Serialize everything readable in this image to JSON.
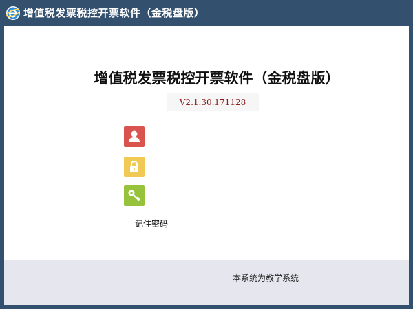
{
  "window": {
    "title": "增值税发票税控开票软件（金税盘版）",
    "app_icon": "ie-e-icon"
  },
  "main": {
    "heading": "增值税发票税控开票软件（金税盘版）",
    "version": "V2.1.30.171128",
    "fields": [
      {
        "icon": "user-icon",
        "color": "#d9534f"
      },
      {
        "icon": "lock-icon",
        "color": "#f0ca55"
      },
      {
        "icon": "key-icon",
        "color": "#96c33b"
      }
    ],
    "remember_label": "记住密码"
  },
  "footer": {
    "note": "本系统为教学系统"
  },
  "colors": {
    "titlebar": "#33506f",
    "version_text": "#8b1a1a",
    "footer_bg": "#e6e6ee"
  }
}
